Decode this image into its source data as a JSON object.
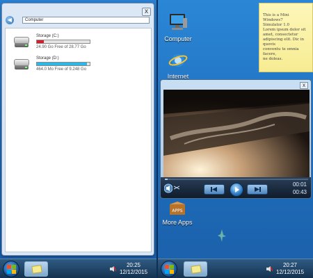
{
  "left": {
    "explorer": {
      "close_label": "x",
      "address": "Computer",
      "drives": [
        {
          "name": "Storage (C:)",
          "free_text": "24.90 Go Free of 28.77 Go",
          "used_fraction": 0.134,
          "bar_color": "#d21f2f"
        },
        {
          "name": "Storage (D:)",
          "free_text": "464.0 Mo Free of 9.248 Go",
          "used_fraction": 0.95,
          "bar_color": "#2bb8e6"
        }
      ]
    },
    "taskbar": {
      "time": "20:25",
      "date": "12/12/2015"
    }
  },
  "right": {
    "desktop_icons": [
      {
        "label": "Computer",
        "icon": "computer-icon"
      },
      {
        "label": "Internet",
        "icon": "internet-explorer-icon"
      },
      {
        "label": "More Apps",
        "icon": "apps-box-icon"
      }
    ],
    "sticky_note": {
      "line1": "This is a  Mini Windows7",
      "line2": "Simulator 1.0",
      "line3": "Lorem ipsum dolor sit",
      "line4": "amet, consectetur",
      "line5": "adipiscing elit. Dic in quovis",
      "line6": "conventu te omnia facere,",
      "line7": "ne doleas."
    },
    "player": {
      "close_label": "x",
      "elapsed": "00:01",
      "duration": "00:43",
      "progress": 0.02
    },
    "taskbar": {
      "time": "20:27",
      "date": "12/12/2015"
    }
  },
  "colors": {
    "taskbar": "#15324f",
    "accent": "#2a78c4"
  }
}
